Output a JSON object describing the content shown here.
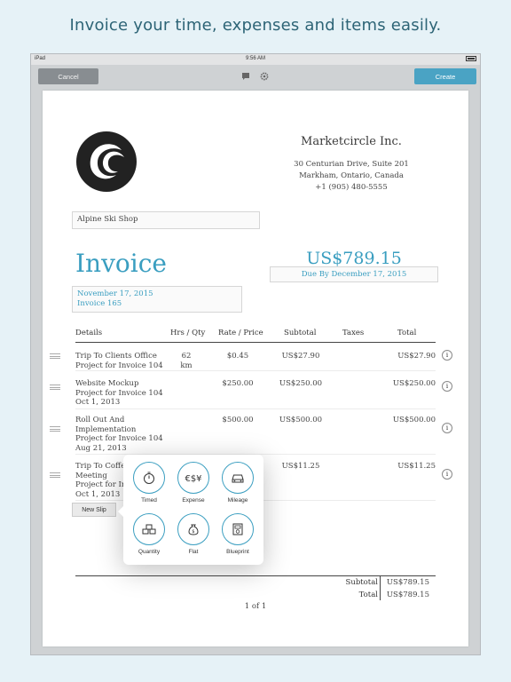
{
  "headline": "Invoice your time, expenses and items easily.",
  "status": {
    "device": "iPad",
    "time": "9:56 AM"
  },
  "toolbar": {
    "cancel": "Cancel",
    "create": "Create"
  },
  "company": {
    "name": "Marketcircle Inc.",
    "address1": "30 Centurian Drive, Suite 201",
    "address2": "Markham, Ontario, Canada",
    "phone": "+1 (905) 480-5555"
  },
  "client": "Alpine Ski Shop",
  "invoice": {
    "title": "Invoice",
    "total": "US$789.15",
    "due": "Due By December 17, 2015",
    "date": "November 17, 2015",
    "number": "Invoice 165"
  },
  "columns": [
    "Details",
    "Hrs / Qty",
    "Rate / Price",
    "Subtotal",
    "Taxes",
    "Total"
  ],
  "rows": [
    {
      "title": "Trip To Clients Office",
      "line2": "Project for Invoice 104",
      "line3": "",
      "line4": "",
      "qty": "62 km",
      "rate": "$0.45",
      "subtotal": "US$27.90",
      "total": "US$27.90"
    },
    {
      "title": "Website Mockup",
      "line2": "Project for Invoice 104",
      "line3": "Oct 1, 2013",
      "line4": "",
      "qty": "",
      "rate": "$250.00",
      "subtotal": "US$250.00",
      "total": "US$250.00"
    },
    {
      "title": "Roll Out And",
      "line2": "Implementation",
      "line3": "Project for Invoice 104",
      "line4": "Aug 21, 2013",
      "qty": "",
      "rate": "$500.00",
      "subtotal": "US$500.00",
      "total": "US$500.00"
    },
    {
      "title": "Trip To Coffe",
      "line2": "Meeting",
      "line3": "Project for In",
      "line4": "Oct 1, 2013",
      "qty": "",
      "rate": "",
      "subtotal": "US$11.25",
      "total": "US$11.25"
    }
  ],
  "new_slip": "New Slip",
  "slip_options": [
    "Timed",
    "Expense",
    "Mileage",
    "Quantity",
    "Flat",
    "Blueprint"
  ],
  "summary": {
    "subtotal_label": "Subtotal",
    "subtotal": "US$789.15",
    "total_label": "Total",
    "total": "US$789.15"
  },
  "page": "1 of 1",
  "colors": {
    "accent": "#3a9ec0",
    "create_button": "#4aa3c4",
    "cancel_button": "#888d91"
  }
}
